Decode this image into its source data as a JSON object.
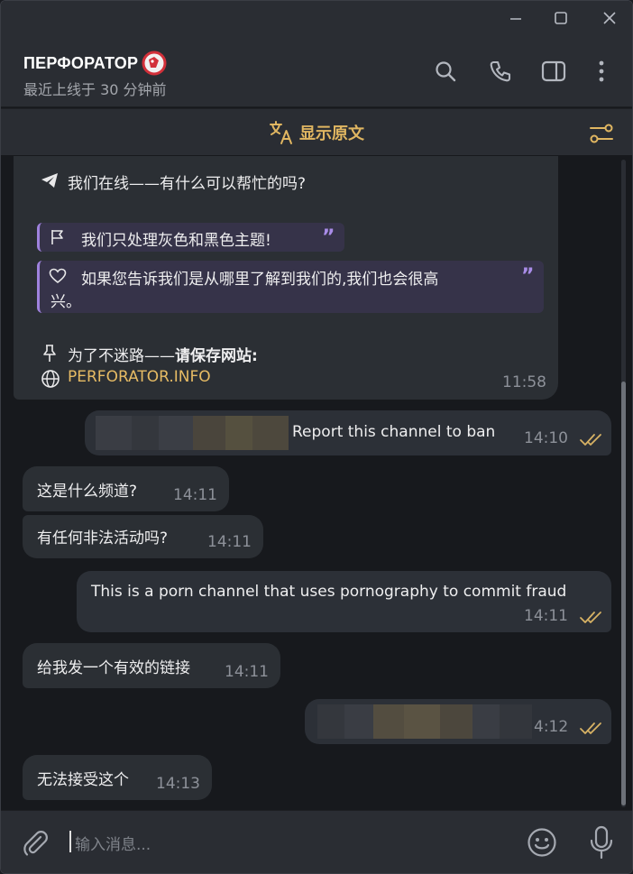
{
  "header": {
    "title": "ПЕРФОРАТОР",
    "status": "最近上线于 30 分钟前"
  },
  "translate": {
    "label": "显示原文"
  },
  "pinned_message": {
    "line1": "我们在线——有什么可以帮忙的吗?",
    "quote1": "我们只处理灰色和黑色主题!",
    "quote2_line1": "如果您告诉我们是从哪里了解到我们的,我们也会很高",
    "quote2_line2": "兴。",
    "save_prefix": "为了不迷路——",
    "save_bold": "请保存网站:",
    "site": "PERFORATOR.INFO",
    "time": "11:58"
  },
  "messages": [
    {
      "dir": "out",
      "text": "Report this channel to ban",
      "time": "14:10"
    },
    {
      "dir": "in",
      "text": "这是什么频道?",
      "time": "14:11"
    },
    {
      "dir": "in",
      "text": "有任何非法活动吗?",
      "time": "14:11"
    },
    {
      "dir": "out",
      "text": "This is a porn channel that uses pornography to commit fraud",
      "time": "14:11"
    },
    {
      "dir": "in",
      "text": "给我发一个有效的链接",
      "time": "14:11"
    },
    {
      "dir": "out",
      "text": "",
      "time": "4:12"
    },
    {
      "dir": "in",
      "text": "无法接受这个",
      "time": "14:13"
    }
  ],
  "input": {
    "placeholder": "输入消息..."
  },
  "colors": {
    "accent": "#e0b661",
    "quote_bar": "#9f82de",
    "bubble_in": "#2b2f34",
    "bubble_out": "#2c3037"
  },
  "icons": [
    "minimize-icon",
    "maximize-icon",
    "close-icon",
    "search-icon",
    "phone-icon",
    "sidebar-icon",
    "more-icon",
    "translate-icon",
    "filter-icon",
    "telegram-icon",
    "flag-icon",
    "heart-icon",
    "pin-icon",
    "globe-icon",
    "double-check-icon",
    "attach-icon",
    "emoji-icon",
    "mic-icon"
  ]
}
